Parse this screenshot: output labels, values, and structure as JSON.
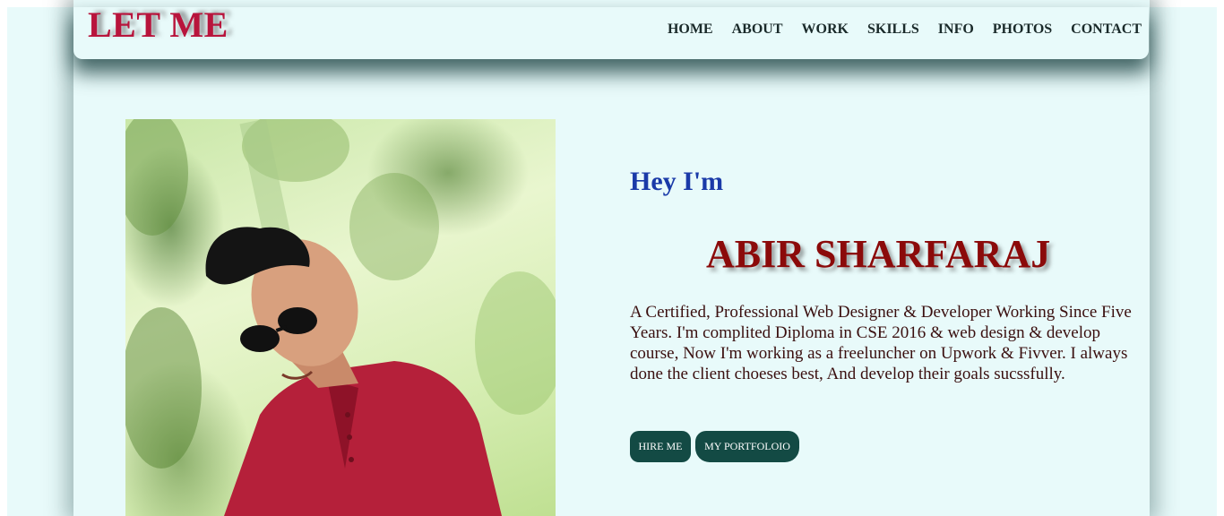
{
  "brand": {
    "logo_text": "LET ME",
    "logo_color": "#b8143c"
  },
  "nav": {
    "items": [
      "HOME",
      "ABOUT",
      "WORK",
      "SKILLS",
      "INFO",
      "PHOTOS",
      "CONTACT"
    ]
  },
  "hero": {
    "greeting": "Hey I'm",
    "name": "ABIR SHARFARAJ",
    "bio": "A Certified, Professional Web Designer & Developer Working Since Five Years. I'm complited Diploma in CSE 2016 & web design & develop course, Now I'm working as a freeluncher on Upwork & Fivver. I always done the client choeses best, And develop their goals sucssfully.",
    "photo_alt": "profile photo"
  },
  "buttons": {
    "hire_label": "HIRE ME",
    "portfolio_label": "MY PORTFOLOIO",
    "button_color": "#134a44"
  },
  "colors": {
    "page_background": "#e8fafa",
    "greeting_color": "#1a3aa8",
    "name_color": "#8b0a0a"
  }
}
